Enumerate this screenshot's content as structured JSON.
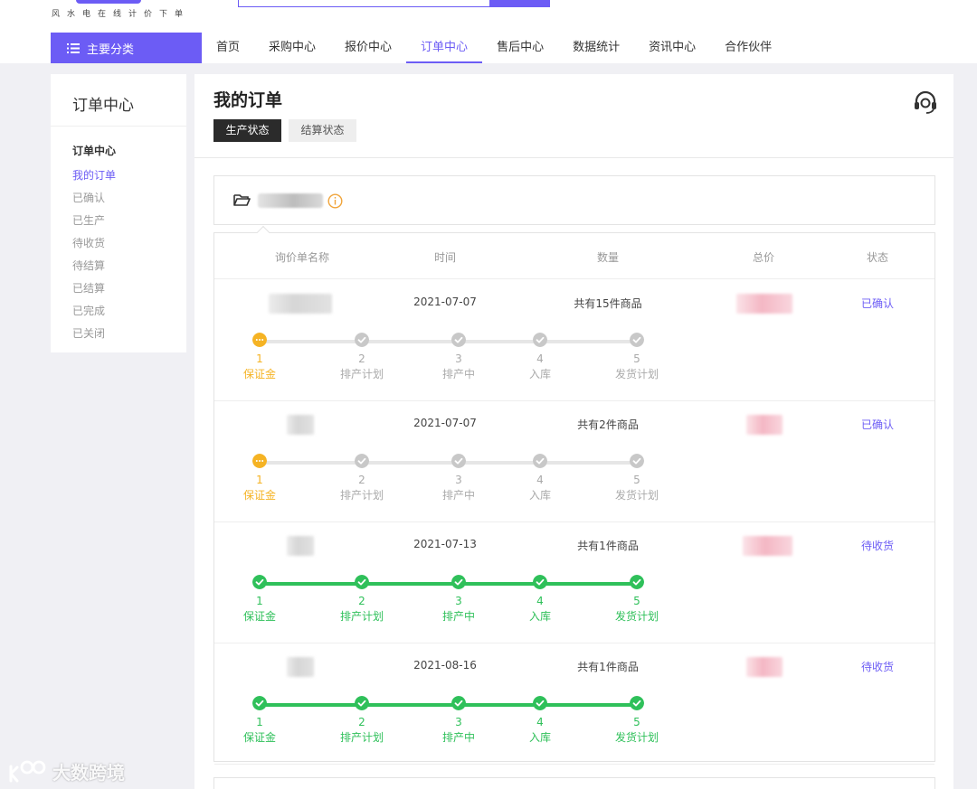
{
  "header": {
    "slogan": "风水电在线计价下单",
    "category_button": "主要分类",
    "nav": [
      "首页",
      "采购中心",
      "报价中心",
      "订单中心",
      "售后中心",
      "数据统计",
      "资讯中心",
      "合作伙伴"
    ],
    "nav_active": "订单中心"
  },
  "sidebar": {
    "title": "订单中心",
    "group": "订单中心",
    "items": [
      "我的订单",
      "已确认",
      "已生产",
      "待收货",
      "待结算",
      "已结算",
      "已完成",
      "已关闭"
    ],
    "active_item": "我的订单"
  },
  "main": {
    "title": "我的订单",
    "tabs": [
      "生产状态",
      "结算状态"
    ],
    "active_tab": "生产状态"
  },
  "table": {
    "headers": [
      "询价单名称",
      "时间",
      "数量",
      "总价",
      "状态"
    ],
    "step_labels": [
      "保证金",
      "排产计划",
      "排产中",
      "入库",
      "发货计划"
    ],
    "step_numbers": [
      "1",
      "2",
      "3",
      "4",
      "5"
    ],
    "orders": [
      {
        "date": "2021-07-07",
        "quantity": "共有15件商品",
        "status": "已确认",
        "steps_completed": 0,
        "current_step": 1
      },
      {
        "date": "2021-07-07",
        "quantity": "共有2件商品",
        "status": "已确认",
        "steps_completed": 0,
        "current_step": 1
      },
      {
        "date": "2021-07-13",
        "quantity": "共有1件商品",
        "status": "待收货",
        "steps_completed": 5,
        "current_step": 0
      },
      {
        "date": "2021-08-16",
        "quantity": "共有1件商品",
        "status": "待收货",
        "steps_completed": 5,
        "current_step": 0
      }
    ]
  },
  "watermark": "大数跨境",
  "colors": {
    "accent": "#6c5cf5",
    "done": "#2fc05a",
    "current": "#f5b324",
    "pending": "#c8c8c8"
  },
  "icons": [
    "menu-icon",
    "headset-icon",
    "folder-icon",
    "info-icon",
    "check-icon",
    "dots-icon"
  ]
}
